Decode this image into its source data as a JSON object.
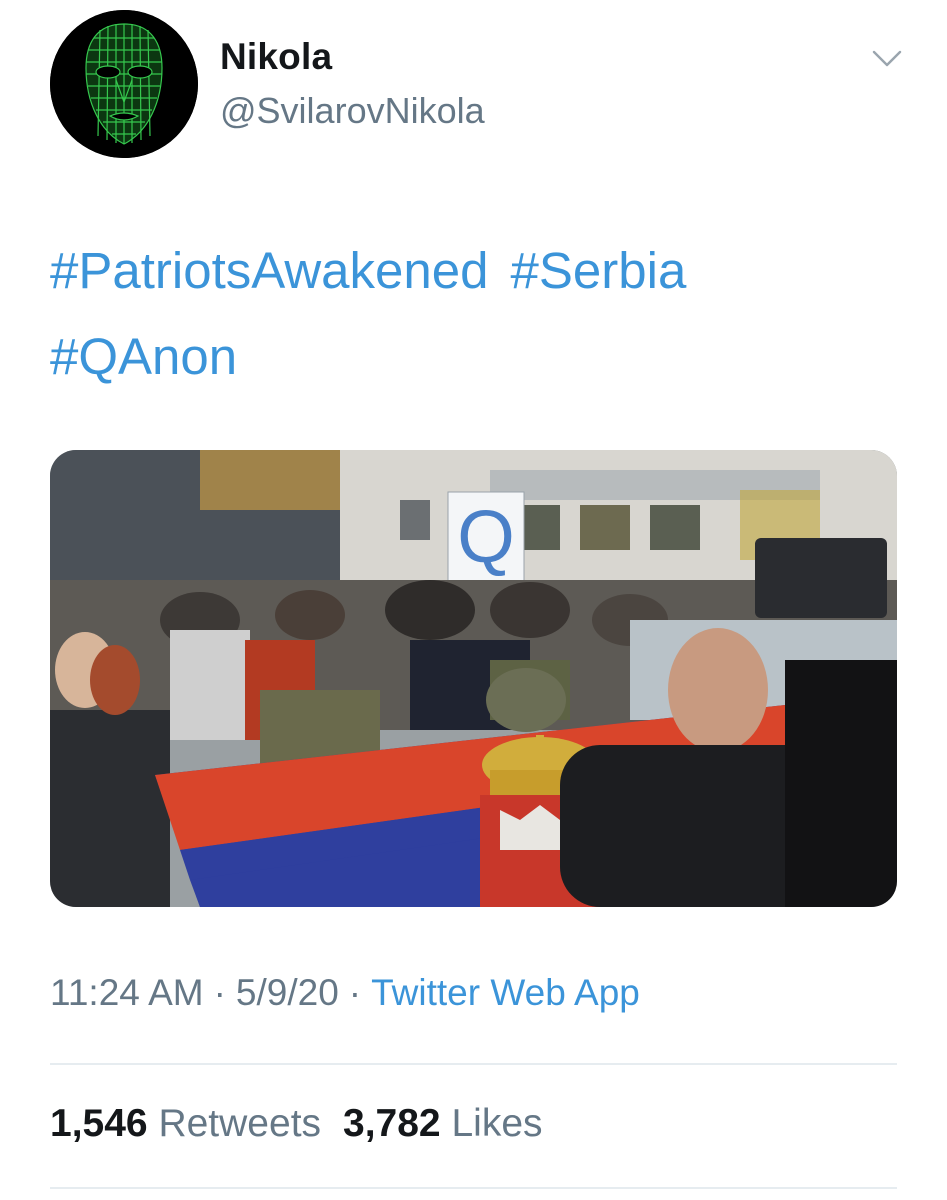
{
  "user": {
    "display_name": "Nikola",
    "handle": "@SvilarovNikola",
    "avatar_icon": "green-wireframe-face-icon"
  },
  "tweet": {
    "hashtags": [
      "#PatriotsAwakened",
      "#Serbia",
      "#QAnon"
    ],
    "media_sign_text": "Q",
    "time": "11:24 AM",
    "date": "5/9/20",
    "separator": "·",
    "source": "Twitter Web App"
  },
  "stats": {
    "retweets_count": "1,546",
    "retweets_label": "Retweets",
    "likes_count": "3,782",
    "likes_label": "Likes"
  },
  "colors": {
    "link": "#3b94d9",
    "secondary_text": "#657786",
    "primary_text": "#14171a",
    "divider": "#e6ecf0",
    "avatar_wireframe": "#39d353",
    "flag_red": "#d9452b",
    "flag_blue": "#2f3f9e",
    "flag_white": "#f2f2f2"
  }
}
